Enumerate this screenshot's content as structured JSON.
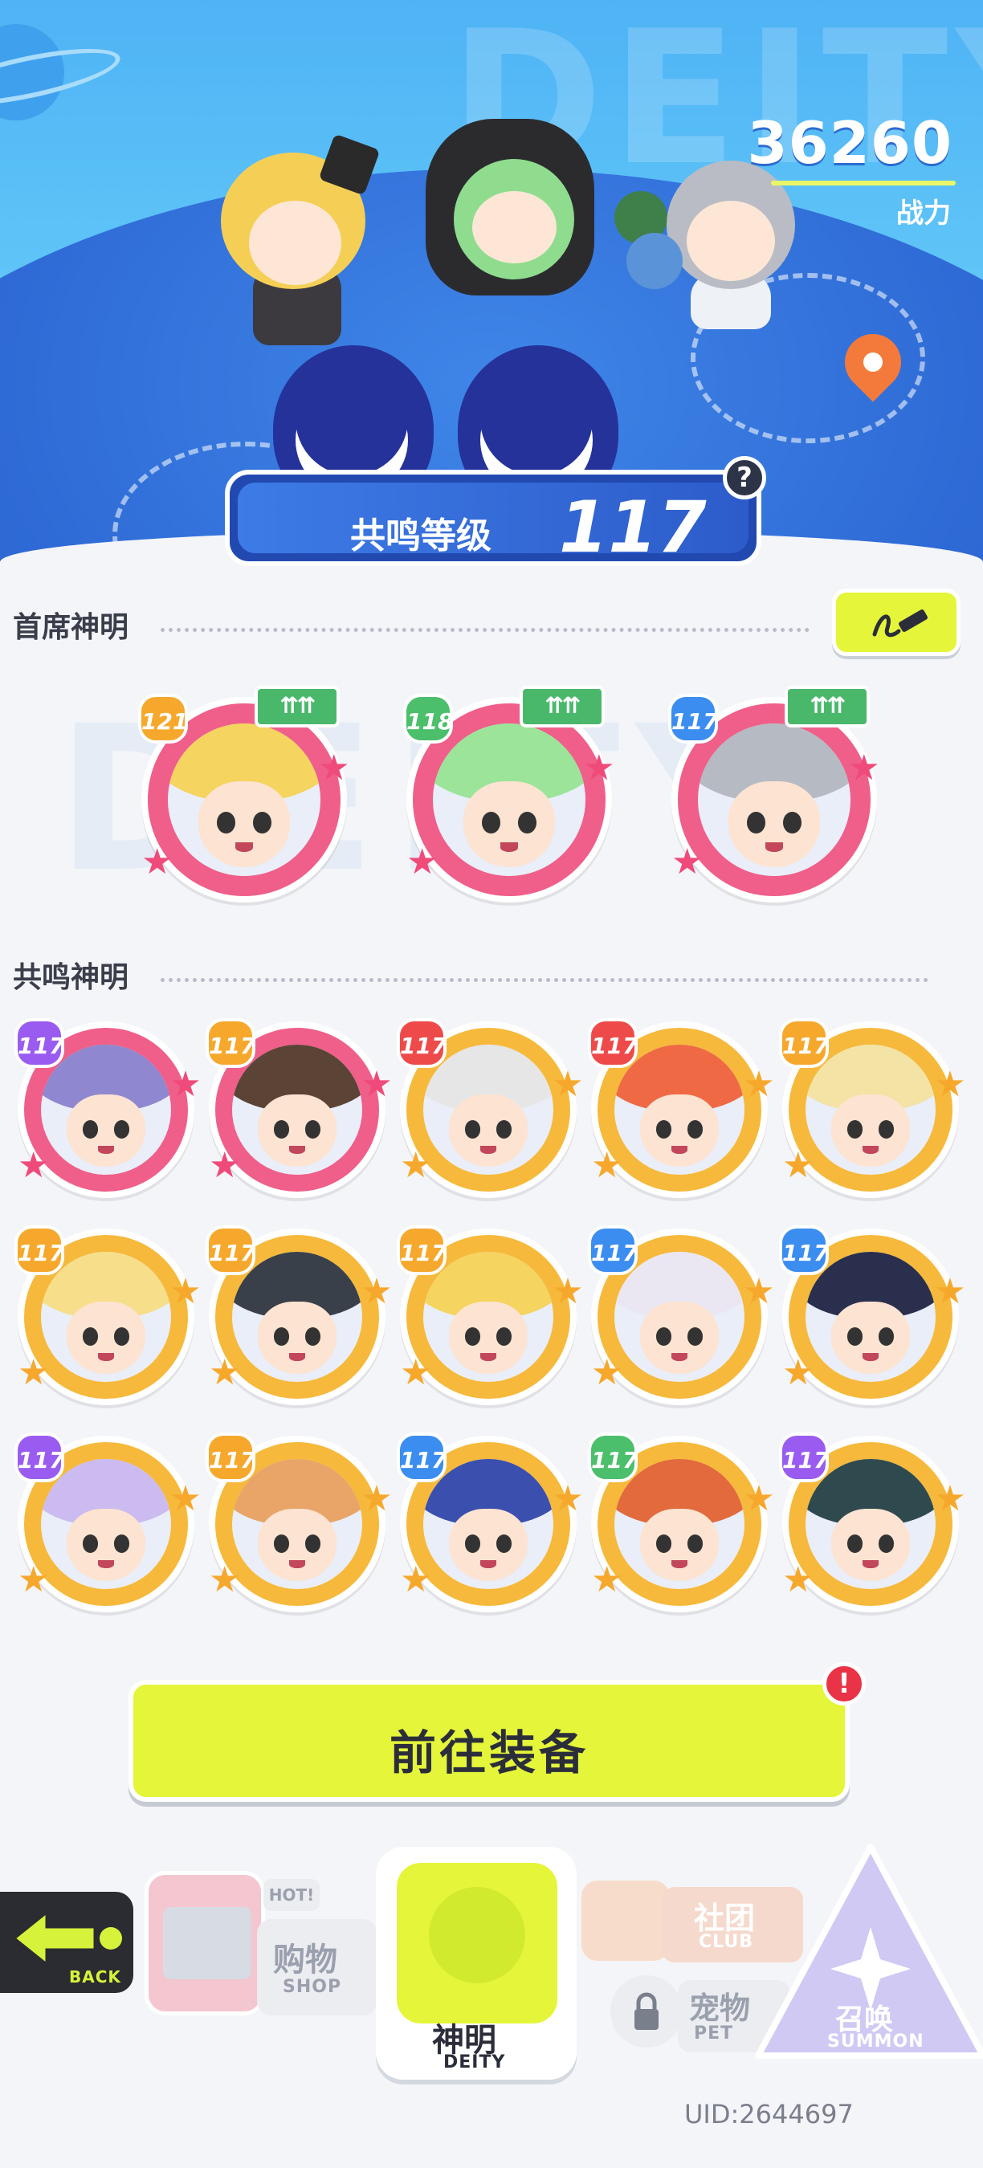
{
  "header": {
    "combat_power": "36260",
    "combat_power_label": "战力",
    "watermark": "DEITY"
  },
  "resonance": {
    "label": "共鸣等级",
    "level": "117",
    "help_icon": "question-icon"
  },
  "first_deities": {
    "title": "首席神明",
    "edit_icon": "pencil-icon",
    "items": [
      {
        "level": "121",
        "badge_color": "#f6a82d",
        "hair": "#f5d45f",
        "ring": "#ef5f8a",
        "upgrade": true
      },
      {
        "level": "118",
        "badge_color": "#4bbf6b",
        "hair": "#9be49a",
        "ring": "#ef5f8a",
        "upgrade": true
      },
      {
        "level": "117",
        "badge_color": "#3b8df0",
        "hair": "#b6bac3",
        "ring": "#ef5f8a",
        "upgrade": true
      }
    ]
  },
  "resonance_deities": {
    "title": "共鸣神明",
    "items": [
      {
        "level": "117",
        "badge_color": "#9a5cf0",
        "hair": "#8f87cf",
        "ring": "#ef5f8a"
      },
      {
        "level": "117",
        "badge_color": "#f6a82d",
        "hair": "#5b4436",
        "ring": "#ef5f8a"
      },
      {
        "level": "117",
        "badge_color": "#ef4a4a",
        "hair": "#e6e6e6",
        "ring": "#f6b93b"
      },
      {
        "level": "117",
        "badge_color": "#ef4a4a",
        "hair": "#ef6a44",
        "ring": "#f6b93b"
      },
      {
        "level": "117",
        "badge_color": "#f6a82d",
        "hair": "#f3e3a5",
        "ring": "#f6b93b"
      },
      {
        "level": "117",
        "badge_color": "#f6a82d",
        "hair": "#f6de8a",
        "ring": "#f6b93b"
      },
      {
        "level": "117",
        "badge_color": "#f6a82d",
        "hair": "#39404a",
        "ring": "#f6b93b"
      },
      {
        "level": "117",
        "badge_color": "#f6a82d",
        "hair": "#f5d45f",
        "ring": "#f6b93b"
      },
      {
        "level": "117",
        "badge_color": "#3b8df0",
        "hair": "#eae7f2",
        "ring": "#f6b93b"
      },
      {
        "level": "117",
        "badge_color": "#3b8df0",
        "hair": "#2b2f4e",
        "ring": "#f6b93b"
      },
      {
        "level": "117",
        "badge_color": "#9a5cf0",
        "hair": "#cbbbf0",
        "ring": "#f6b93b"
      },
      {
        "level": "117",
        "badge_color": "#f6a82d",
        "hair": "#e9a568",
        "ring": "#f6b93b"
      },
      {
        "level": "117",
        "badge_color": "#3b8df0",
        "hair": "#3b4fae",
        "ring": "#f6b93b"
      },
      {
        "level": "117",
        "badge_color": "#4bbf6b",
        "hair": "#e26a3c",
        "ring": "#f6b93b"
      },
      {
        "level": "117",
        "badge_color": "#9a5cf0",
        "hair": "#2f4a4e",
        "ring": "#f6b93b"
      }
    ]
  },
  "equip_button": {
    "label": "前往装备",
    "alert": "!"
  },
  "nav": {
    "back": {
      "en": "BACK"
    },
    "shop": {
      "cn": "购物",
      "en": "SHOP",
      "tag": "HOT!"
    },
    "deity": {
      "cn": "神明",
      "en": "DEITY"
    },
    "club": {
      "cn": "社团",
      "en": "CLUB"
    },
    "pet": {
      "cn": "宠物",
      "en": "PET"
    },
    "summon": {
      "cn": "召唤",
      "en": "SUMMON"
    }
  },
  "uid": "UID:2644697"
}
